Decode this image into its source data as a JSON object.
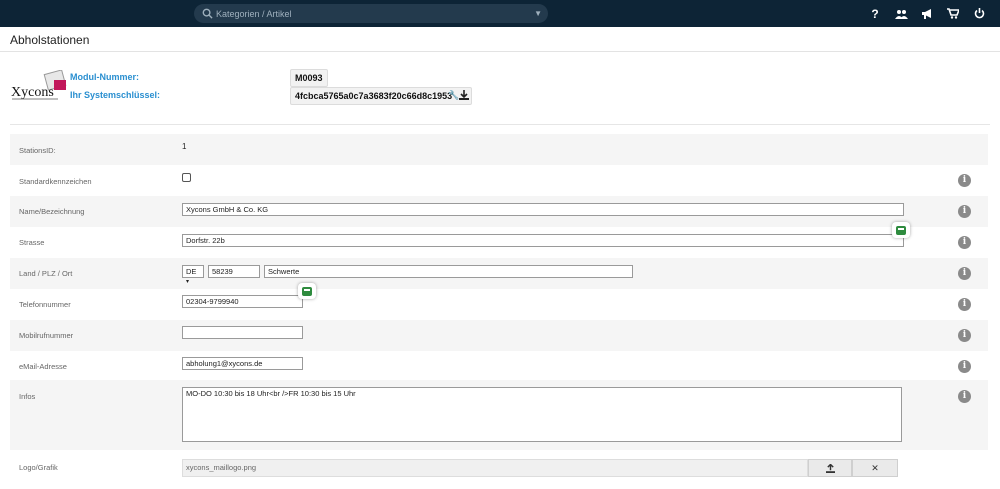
{
  "header": {
    "search_placeholder": "Kategorien / Artikel",
    "icons": [
      "help-icon",
      "users-icon",
      "megaphone-icon",
      "cart-icon",
      "power-icon"
    ]
  },
  "page": {
    "title": "Abholstationen"
  },
  "module": {
    "logo_text": "Xycons",
    "modul_label": "Modul-Nummer:",
    "modul_value": "M0093",
    "key_label": "Ihr Systemschlüssel:",
    "key_value": "4fcbca5765a0c7a3683f20c66d8c1953"
  },
  "form": {
    "stationsid": {
      "label": "StationsID:",
      "value": "1"
    },
    "standard": {
      "label": "Standardkennzeichen"
    },
    "name": {
      "label": "Name/Bezeichnung",
      "value": "Xycons GmbH & Co. KG"
    },
    "strasse": {
      "label": "Strasse",
      "value": "Dorfstr. 22b"
    },
    "land": {
      "label": "Land / PLZ / Ort",
      "country": "DE",
      "plz": "58239",
      "ort": "Schwerte"
    },
    "telefon": {
      "label": "Telefonnummer",
      "value": "02304-9799940"
    },
    "mobil": {
      "label": "Mobilrufnummer",
      "value": ""
    },
    "email": {
      "label": "eMail-Adresse",
      "value": "abholung1@xycons.de"
    },
    "infos": {
      "label": "Infos",
      "value": "MO-DO 10:30 bis 18 Uhr<br />FR 10:30 bis 15 Uhr"
    },
    "logo": {
      "label": "Logo/Grafik",
      "value": "xycons_maillogo.png"
    }
  }
}
